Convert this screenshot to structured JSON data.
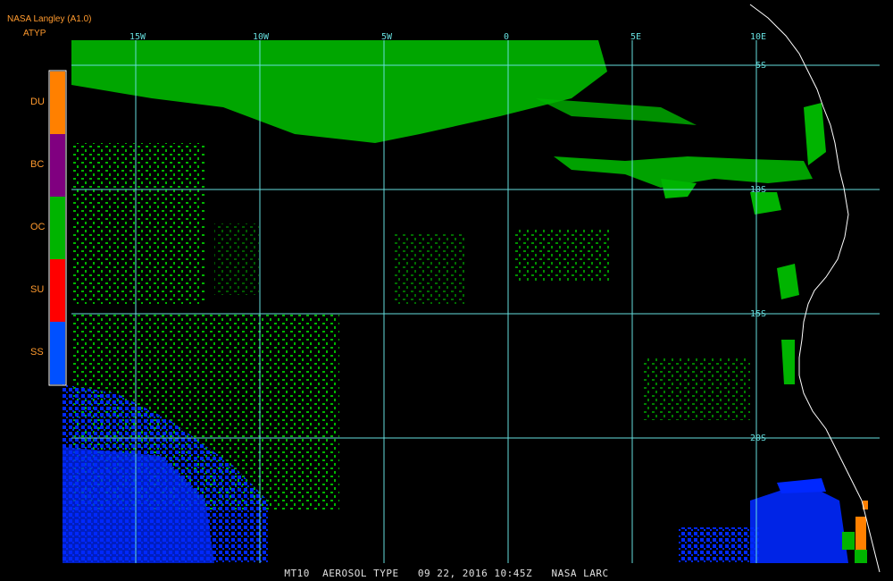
{
  "header": {
    "title": "NASA Langley (A1.0)",
    "product": "ATYP",
    "text_color": "#ff9a2e"
  },
  "legend": {
    "items": [
      {
        "code": "DU",
        "color": "#ff8000"
      },
      {
        "code": "BC",
        "color": "#800080"
      },
      {
        "code": "OC",
        "color": "#00b400"
      },
      {
        "code": "SU",
        "color": "#ff0000"
      },
      {
        "code": "SS",
        "color": "#0050ff"
      }
    ],
    "label_color": "#ff9a2e"
  },
  "map": {
    "grid_color": "#66dede",
    "coast_color": "#ffffff",
    "background": "#000000",
    "lon_labels": [
      "15W",
      "10W",
      "5W",
      "0",
      "5E",
      "10E"
    ],
    "lat_labels": [
      "5S",
      "10S",
      "15S",
      "20S"
    ]
  },
  "footer": {
    "text": "MT10  AEROSOL TYPE   09 22, 2016 10:45Z   NASA LARC",
    "color": "#e0e0e0"
  }
}
